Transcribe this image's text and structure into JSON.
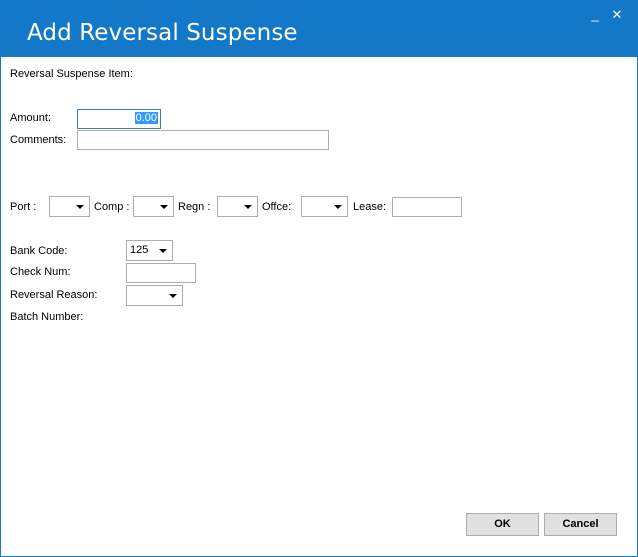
{
  "window": {
    "title": "Add Reversal Suspense",
    "minimize_glyph": "_",
    "close_glyph": "✕"
  },
  "form": {
    "section_label": "Reversal Suspense Item:",
    "amount_label": "Amount:",
    "amount_value": "0.00",
    "comments_label": "Comments:",
    "comments_value": "",
    "port_label": "Port :",
    "comp_label": "Comp :",
    "regn_label": "Regn :",
    "offce_label": "Offce:",
    "lease_label": "Lease:",
    "lease_value": "",
    "bank_code_label": "Bank Code:",
    "bank_code_value": "125",
    "check_num_label": "Check Num:",
    "check_num_value": "",
    "reversal_reason_label": "Reversal Reason:",
    "reversal_reason_value": "",
    "batch_number_label": "Batch Number:"
  },
  "buttons": {
    "ok_label": "OK",
    "cancel_label": "Cancel"
  },
  "icons": {
    "dropdown": "chevron-down-icon"
  },
  "colors": {
    "title_bar": "#1478c8",
    "selection": "#3399ff"
  }
}
